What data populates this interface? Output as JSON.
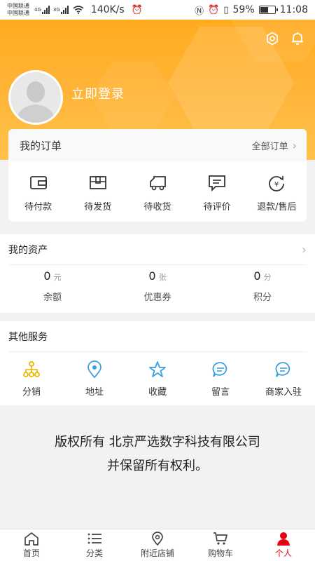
{
  "status_bar": {
    "carrier_1": "中国联通",
    "carrier_2": "中国联通",
    "net_1": "4G",
    "net_2": "3G",
    "speed": "140K/s",
    "battery": "59%",
    "battery_level": 0.59,
    "time": "11:08"
  },
  "header": {
    "login": "立即登录",
    "settings_icon": "gear-icon",
    "notifications_icon": "bell-icon",
    "bg_color": "#ffb02e"
  },
  "orders": {
    "title": "我的订单",
    "all_orders": "全部订单",
    "items": [
      {
        "label": "待付款",
        "icon": "wallet-icon"
      },
      {
        "label": "待发货",
        "icon": "box-icon"
      },
      {
        "label": "待收货",
        "icon": "truck-icon"
      },
      {
        "label": "待评价",
        "icon": "comment-icon"
      },
      {
        "label": "退款/售后",
        "icon": "refund-icon"
      }
    ]
  },
  "assets": {
    "title": "我的资产",
    "items": [
      {
        "value": "0",
        "unit": "元",
        "label": "余额"
      },
      {
        "value": "0",
        "unit": "张",
        "label": "优惠券"
      },
      {
        "value": "0",
        "unit": "分",
        "label": "积分"
      }
    ]
  },
  "services": {
    "title": "其他服务",
    "items": [
      {
        "label": "分销",
        "icon": "network-icon",
        "color": "#e8b400"
      },
      {
        "label": "地址",
        "icon": "location-pin-icon",
        "color": "#3aa0e0"
      },
      {
        "label": "收藏",
        "icon": "star-icon",
        "color": "#3aa0e0"
      },
      {
        "label": "留言",
        "icon": "chat-bubble-icon",
        "color": "#3aa0e0"
      },
      {
        "label": "商家入驻",
        "icon": "chat-bubble-icon",
        "color": "#3aa0e0"
      }
    ]
  },
  "copyright": {
    "line1": "版权所有 北京严选数字科技有限公司",
    "line2": "并保留所有权利。"
  },
  "tabbar": {
    "items": [
      {
        "label": "首页",
        "icon": "home-icon"
      },
      {
        "label": "分类",
        "icon": "list-icon"
      },
      {
        "label": "附近店铺",
        "icon": "location-pin-icon"
      },
      {
        "label": "购物车",
        "icon": "cart-icon"
      },
      {
        "label": "个人",
        "icon": "person-icon"
      }
    ],
    "active_index": 4,
    "active_color": "#e60012"
  }
}
